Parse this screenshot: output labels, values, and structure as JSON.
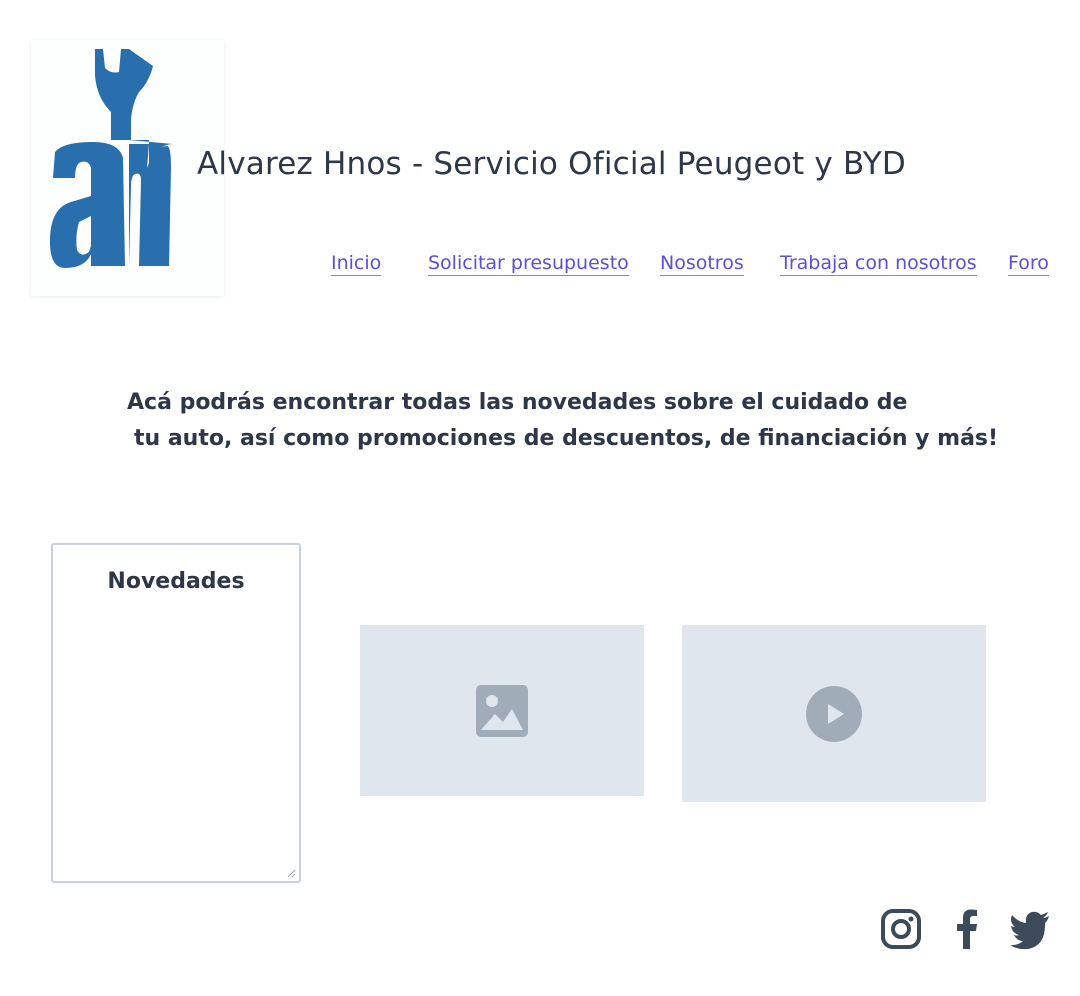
{
  "header": {
    "title": "Alvarez Hnos - Servicio Oficial Peugeot y BYD",
    "logo_text": "ah"
  },
  "nav": {
    "items": [
      {
        "label": "Inicio"
      },
      {
        "label": "Solicitar presupuesto"
      },
      {
        "label": "Nosotros"
      },
      {
        "label": "Trabaja con nosotros"
      },
      {
        "label": "Foro"
      }
    ]
  },
  "intro": {
    "line1": "Acá podrás encontrar todas las novedades sobre el cuidado de",
    "line2": "tu auto, así como promociones de descuentos, de financiación y más!"
  },
  "news": {
    "title": "Novedades"
  },
  "placeholders": {
    "image_icon": "image-placeholder-icon",
    "video_icon": "play-icon"
  },
  "social": {
    "icons": [
      "instagram-icon",
      "facebook-icon",
      "twitter-icon"
    ]
  },
  "colors": {
    "logo_blue": "#2a6fad",
    "link": "#5a4fd8",
    "text": "#2d3748",
    "placeholder_bg": "#e0e6ee",
    "placeholder_icon": "#a0adb8"
  }
}
